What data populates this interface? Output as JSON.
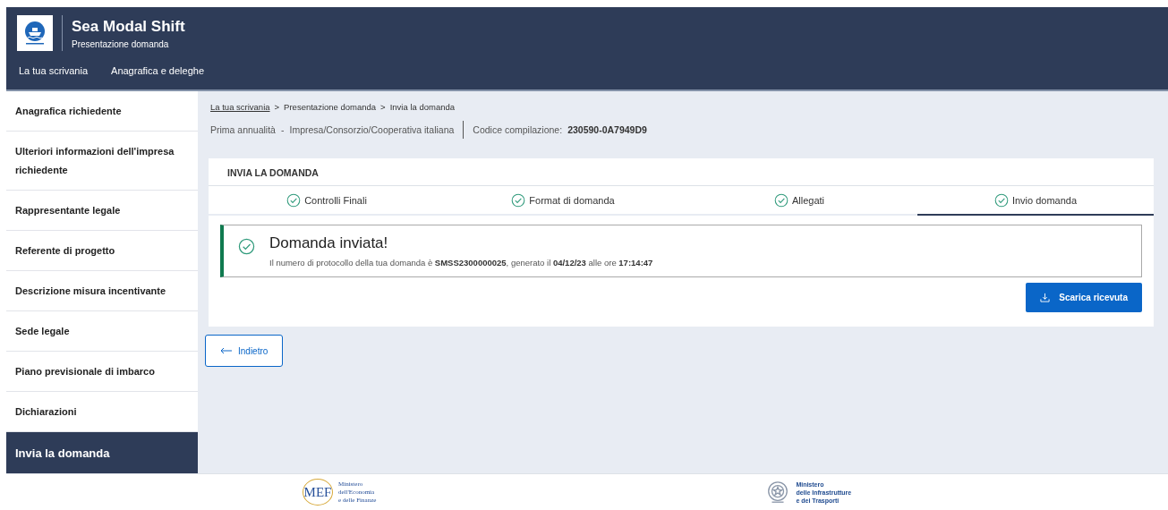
{
  "header": {
    "title": "Sea Modal Shift",
    "subtitle": "Presentazione domanda",
    "nav": [
      {
        "label": "La tua scrivania"
      },
      {
        "label": "Anagrafica e deleghe"
      }
    ]
  },
  "sidebar": {
    "items": [
      {
        "label": "Anagrafica richiedente",
        "selected": false
      },
      {
        "label": "Ulteriori informazioni dell'impresa richiedente",
        "selected": false
      },
      {
        "label": "Rappresentante legale",
        "selected": false
      },
      {
        "label": "Referente di progetto",
        "selected": false
      },
      {
        "label": "Descrizione misura incentivante",
        "selected": false
      },
      {
        "label": "Sede legale",
        "selected": false
      },
      {
        "label": "Piano previsionale di imbarco",
        "selected": false
      },
      {
        "label": "Dichiarazioni",
        "selected": false
      },
      {
        "label": "Invia la domanda",
        "selected": true
      }
    ]
  },
  "breadcrumb": [
    {
      "label": "La tua scrivania",
      "kind": "link"
    },
    {
      "label": "Presentazione domanda",
      "kind": "text"
    },
    {
      "label": "Invia la domanda",
      "kind": "text"
    }
  ],
  "breadcrumb_separator": ">",
  "info": {
    "annuality": "Prima annualità",
    "separator": "-",
    "type": "Impresa/Consorzio/Cooperativa italiana",
    "code_label": "Codice compilazione:",
    "code": "230590-0A7949D9"
  },
  "card": {
    "title": "INVIA LA DOMANDA",
    "tabs": [
      {
        "label": "Controlli Finali",
        "selected": false
      },
      {
        "label": "Format di domanda",
        "selected": false
      },
      {
        "label": "Allegati",
        "selected": false
      },
      {
        "label": "Invio domanda",
        "selected": true
      }
    ],
    "alert": {
      "title": "Domanda inviata!",
      "message": "Il numero di protocollo della tua domanda è **SMSS2300000025**, generato il **04/12/23** alle ore **17:14:47**"
    },
    "download_button": "Scarica ricevuta"
  },
  "back_button": "Indietro",
  "footer": {
    "mef_mark": "MEF",
    "mef_text": [
      "Ministero",
      "dell'Economia",
      "e delle Finanze"
    ],
    "mit_text": [
      "Ministero",
      "delle Infrastrutture",
      "e dei Trasporti"
    ]
  }
}
